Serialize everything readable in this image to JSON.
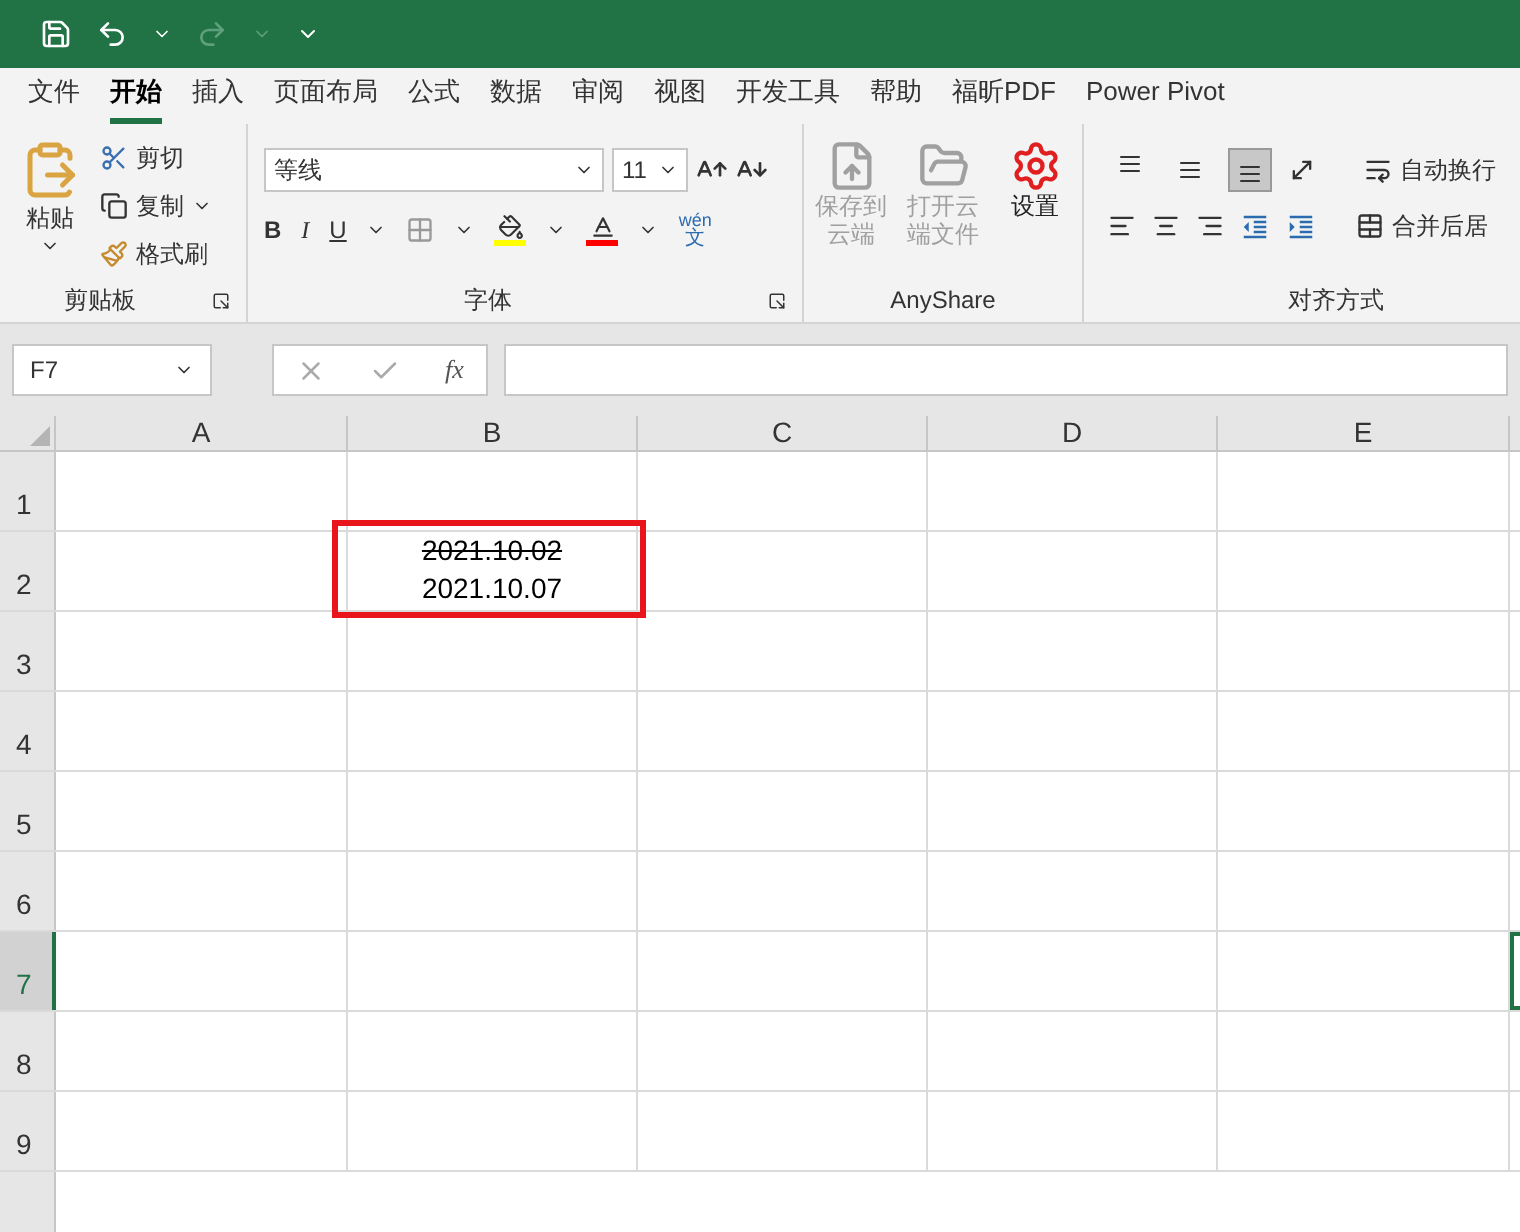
{
  "tabs": [
    {
      "label": "文件",
      "selected": false
    },
    {
      "label": "开始",
      "selected": true
    },
    {
      "label": "插入",
      "selected": false
    },
    {
      "label": "页面布局",
      "selected": false
    },
    {
      "label": "公式",
      "selected": false
    },
    {
      "label": "数据",
      "selected": false
    },
    {
      "label": "审阅",
      "selected": false
    },
    {
      "label": "视图",
      "selected": false
    },
    {
      "label": "开发工具",
      "selected": false
    },
    {
      "label": "帮助",
      "selected": false
    },
    {
      "label": "福昕PDF",
      "selected": false
    },
    {
      "label": "Power Pivot",
      "selected": false
    }
  ],
  "clipboard": {
    "title": "剪贴板",
    "paste": "粘贴",
    "cut": "剪切",
    "copy": "复制",
    "format_painter": "格式刷"
  },
  "font": {
    "title": "字体",
    "name": "等线",
    "size": "11",
    "bold": "B",
    "italic": "I",
    "underline": "U",
    "phonetic_top": "wén",
    "phonetic_bottom": "文"
  },
  "anyshare": {
    "title": "AnyShare",
    "buttons": [
      {
        "label": "保存到云端",
        "kind": "upload",
        "disabled": true
      },
      {
        "label": "打开云端文件",
        "kind": "open",
        "disabled": true
      },
      {
        "label": "设置",
        "kind": "settings",
        "disabled": false
      }
    ]
  },
  "alignment": {
    "title": "对齐方式",
    "vertical": [
      {
        "kind": "top",
        "selected": false
      },
      {
        "kind": "middle",
        "selected": false
      },
      {
        "kind": "bottom",
        "selected": true
      }
    ],
    "wrap": "自动换行",
    "merge": "合并后居"
  },
  "formula_bar": {
    "name_box": "F7",
    "function_label": "fx"
  },
  "columns": [
    {
      "label": "A"
    },
    {
      "label": "B"
    },
    {
      "label": "C"
    },
    {
      "label": "D"
    },
    {
      "label": "E"
    }
  ],
  "rows": [
    {
      "label": "1",
      "selected": false
    },
    {
      "label": "2",
      "selected": false,
      "cells": [
        {},
        {
          "lines": [
            {
              "text": "2021.10.02",
              "struck": true
            },
            {
              "text": "2021.10.07",
              "struck": false
            }
          ]
        }
      ]
    },
    {
      "label": "3",
      "selected": false
    },
    {
      "label": "4",
      "selected": false
    },
    {
      "label": "5",
      "selected": false
    },
    {
      "label": "6",
      "selected": false
    },
    {
      "label": "7",
      "selected": true
    },
    {
      "label": "8",
      "selected": false
    },
    {
      "label": "9",
      "selected": false
    }
  ]
}
